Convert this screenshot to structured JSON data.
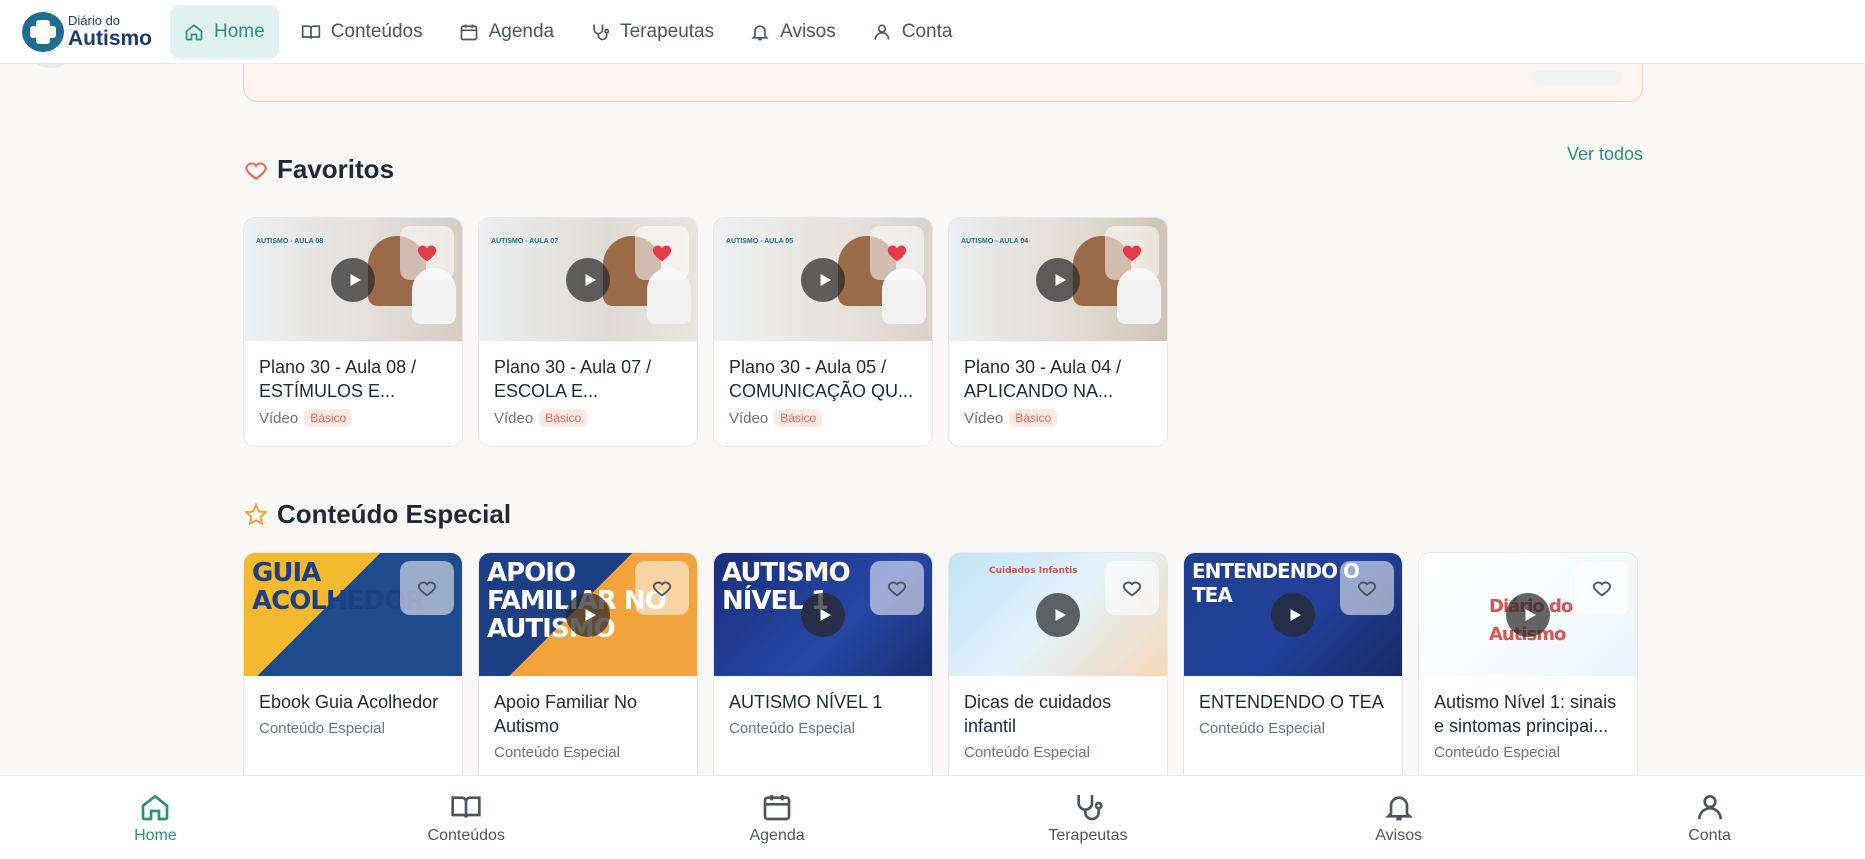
{
  "brand": {
    "line1": "Diário do",
    "line2": "Autismo"
  },
  "colors": {
    "accent": "#2a8f7f",
    "heart": "#e23b4a",
    "badge_text": "#e26d55",
    "star": "#f2a33b"
  },
  "top_nav": [
    {
      "label": "Home",
      "icon": "home-icon",
      "active": true
    },
    {
      "label": "Conteúdos",
      "icon": "book-icon",
      "active": false
    },
    {
      "label": "Agenda",
      "icon": "calendar-icon",
      "active": false
    },
    {
      "label": "Terapeutas",
      "icon": "stethoscope-icon",
      "active": false
    },
    {
      "label": "Avisos",
      "icon": "bell-icon",
      "active": false
    },
    {
      "label": "Conta",
      "icon": "user-icon",
      "active": false
    }
  ],
  "favorites": {
    "title": "Favoritos",
    "see_all": "Ver todos",
    "items": [
      {
        "thumb_label": "AUTISMO - AULA 08",
        "title": "Plano 30 - Aula 08 / ESTÍMULOS E...",
        "type": "Vídeo",
        "badge": "Básico",
        "favorited": true
      },
      {
        "thumb_label": "AUTISMO - AULA 07",
        "title": "Plano 30 - Aula 07 / ESCOLA E...",
        "type": "Vídeo",
        "badge": "Básico",
        "favorited": true
      },
      {
        "thumb_label": "AUTISMO - AULA 05",
        "title": "Plano 30 - Aula 05 / COMUNICAÇÃO QU...",
        "type": "Vídeo",
        "badge": "Básico",
        "favorited": true
      },
      {
        "thumb_label": "AUTISMO - AULA 04",
        "title": "Plano 30 - Aula 04 / APLICANDO NA...",
        "type": "Vídeo",
        "badge": "Básico",
        "favorited": true
      }
    ]
  },
  "special": {
    "title": "Conteúdo Especial",
    "items": [
      {
        "thumb_text": "GUIA ACOLHEDOR",
        "title": "Ebook Guia Acolhedor",
        "category": "Conteúdo Especial",
        "has_play": false
      },
      {
        "thumb_text": "APOIO FAMILIAR NO AUTISMO",
        "title": "Apoio Familiar No Autismo",
        "category": "Conteúdo Especial",
        "has_play": true
      },
      {
        "thumb_text": "AUTISMO NÍVEL 1",
        "title": "AUTISMO NÍVEL 1",
        "category": "Conteúdo Especial",
        "has_play": true
      },
      {
        "thumb_text": "Cuidados Infantis",
        "title": "Dicas de cuidados infantil",
        "category": "Conteúdo Especial",
        "has_play": true
      },
      {
        "thumb_text": "ENTENDENDO O TEA",
        "title": "ENTENDENDO O TEA",
        "category": "Conteúdo Especial",
        "has_play": true
      },
      {
        "thumb_text": "Diário do Autismo",
        "title": "Autismo Nível 1: sinais e sintomas principai...",
        "category": "Conteúdo Especial",
        "has_play": true
      }
    ]
  },
  "bottom_nav": [
    {
      "label": "Home",
      "icon": "home-icon",
      "active": true
    },
    {
      "label": "Conteúdos",
      "icon": "book-icon",
      "active": false
    },
    {
      "label": "Agenda",
      "icon": "calendar-icon",
      "active": false
    },
    {
      "label": "Terapeutas",
      "icon": "stethoscope-icon",
      "active": false
    },
    {
      "label": "Avisos",
      "icon": "bell-icon",
      "active": false
    },
    {
      "label": "Conta",
      "icon": "user-icon",
      "active": false
    }
  ]
}
